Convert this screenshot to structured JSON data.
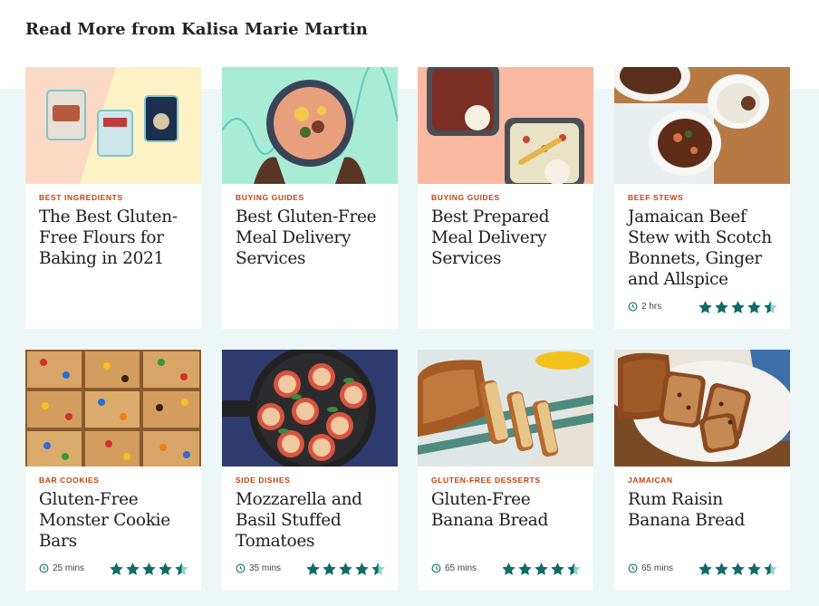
{
  "section": {
    "title": "Read More from Kalisa Marie Martin"
  },
  "colors": {
    "accent_tag": "#c2410c",
    "star": "#0f6b66",
    "band": "#edf7f7"
  },
  "cards": [
    {
      "tag": "Best Ingredients",
      "title": "The Best Gluten-Free Flours for Baking in 2021",
      "image": "gluten-free-flour-bags-image"
    },
    {
      "tag": "Buying Guides",
      "title": "Best Gluten-Free Meal Delivery Services",
      "image": "bowl-of-soup-image"
    },
    {
      "tag": "Buying Guides",
      "title": "Best Prepared Meal Delivery Services",
      "image": "meal-prep-containers-image"
    },
    {
      "tag": "Beef Stews",
      "title": "Jamaican Beef Stew with Scotch Bonnets, Ginger and Allspice",
      "image": "beef-stew-bowls-image",
      "time": "2 hrs",
      "rating": 4.5
    },
    {
      "tag": "Bar Cookies",
      "title": "Gluten-Free Monster Cookie Bars",
      "image": "monster-cookie-bars-image",
      "time": "25 mins",
      "rating": 4.5
    },
    {
      "tag": "Side Dishes",
      "title": "Mozzarella and Basil Stuffed Tomatoes",
      "image": "stuffed-tomatoes-skillet-image",
      "time": "35 mins",
      "rating": 4.5
    },
    {
      "tag": "Gluten-Free Desserts",
      "title": "Gluten-Free Banana Bread",
      "image": "banana-bread-loaf-image",
      "time": "65 mins",
      "rating": 4.5
    },
    {
      "tag": "Jamaican",
      "title": "Rum Raisin Banana Bread",
      "image": "rum-raisin-bread-image",
      "time": "65 mins",
      "rating": 4.5
    }
  ]
}
